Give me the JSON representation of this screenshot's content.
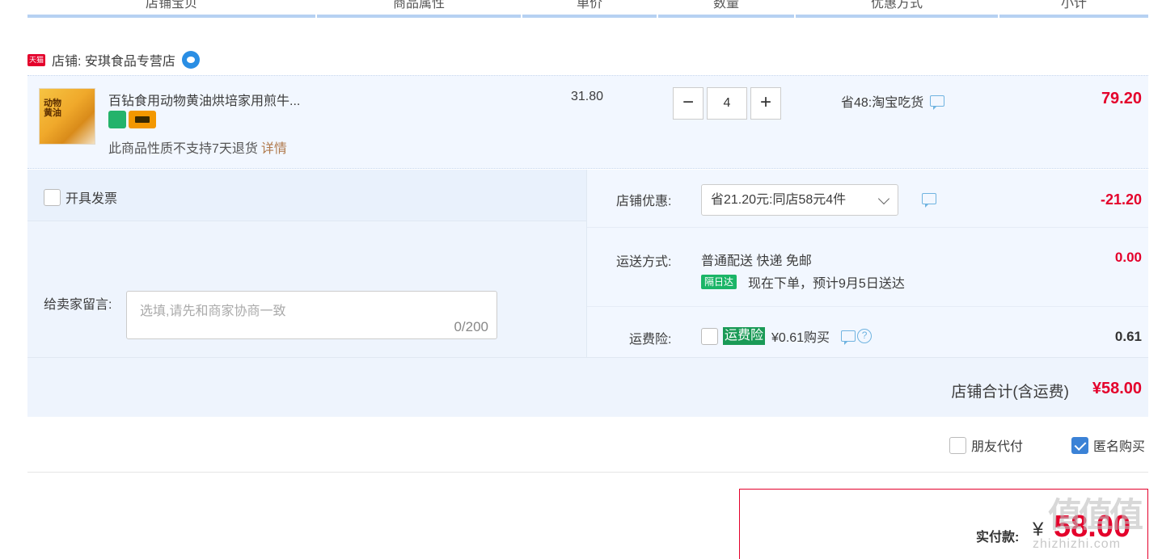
{
  "header": {
    "columns": [
      "店铺宝贝",
      "商品属性",
      "单价",
      "数量",
      "优惠方式",
      "小计"
    ]
  },
  "shop": {
    "badge": "天猫",
    "name": "店铺: 安琪食品专营店"
  },
  "item": {
    "title": "百钻食用动物黄油烘培家用煎牛...",
    "thumb_text": "动物黄油",
    "non_return_text": "此商品性质不支持7天退货",
    "detail_link": "详情",
    "unit_price": "31.80",
    "quantity": "4",
    "minus": "−",
    "plus": "+",
    "promo": "省48:淘宝吃货",
    "subtotal": "79.20"
  },
  "invoice": {
    "label": "开具发票"
  },
  "message": {
    "label": "给卖家留言:",
    "placeholder": "选填,请先和商家协商一致",
    "counter": "0/200"
  },
  "shop_discount": {
    "label": "店铺优惠:",
    "selected": "省21.20元:同店58元4件",
    "amount": "-21.20"
  },
  "shipping": {
    "label": "运送方式:",
    "method": "普通配送 快递 免邮",
    "tag": "隔日达",
    "eta": "现在下单，预计9月5日送达",
    "amount": "0.00"
  },
  "insurance": {
    "label": "运费险:",
    "tag": "运费险",
    "price": "¥0.61购买",
    "help": "?",
    "amount": "0.61"
  },
  "shop_total": {
    "label": "店铺合计(含运费)",
    "amount": "¥58.00"
  },
  "options": {
    "friend_pay": "朋友代付",
    "anonymous": "匿名购买"
  },
  "payment": {
    "label": "实付款:",
    "currency": "¥",
    "amount": "58.00"
  },
  "watermark": {
    "main": "值值值",
    "site": "zhizhizhi.com"
  },
  "colors": {
    "price_red": "#e4002b",
    "header_border": "#b6d1f2",
    "row_bg": "#f2f7ff",
    "checkbox_blue": "#3b82d6",
    "tag_green": "#1bb567"
  }
}
